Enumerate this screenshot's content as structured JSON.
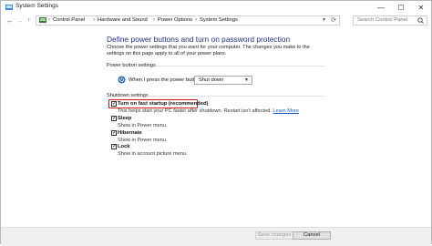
{
  "window": {
    "title": "System Settings",
    "controls": {
      "minimize": "—",
      "maximize": "☐",
      "close": "✕"
    }
  },
  "nav": {
    "back": "←",
    "forward": "→",
    "up": "↑",
    "breadcrumbs": [
      "Control Panel",
      "Hardware and Sound",
      "Power Options",
      "System Settings"
    ],
    "separator": "›",
    "search_placeholder": "Search Control Panel"
  },
  "main": {
    "heading": "Define power buttons and turn on password protection",
    "intro": "Choose the power settings that you want for your computer. The changes you make to the settings on this page apply to all of your power plans.",
    "power_button_section": {
      "label": "Power button settings",
      "row_label": "When I press the power button:",
      "selected": "Shut down"
    },
    "shutdown_section": {
      "label": "Shutdown settings",
      "items": [
        {
          "label": "Turn on fast startup (recommended)",
          "checked": true,
          "desc": "This helps start your PC faster after shutdown. Restart isn't affected.",
          "link": "Learn More",
          "highlighted": true
        },
        {
          "label": "Sleep",
          "checked": true,
          "desc": "Show in Power menu."
        },
        {
          "label": "Hibernate",
          "checked": true,
          "desc": "Show in Power menu."
        },
        {
          "label": "Lock",
          "checked": true,
          "desc": "Show in account picture menu."
        }
      ]
    }
  },
  "footer": {
    "save_label": "Save changes",
    "cancel_label": "Cancel"
  },
  "check_mark": "✓",
  "colors": {
    "heading": "#1e3287",
    "link": "#1a5bc4",
    "highlight": "#d11b1b"
  }
}
